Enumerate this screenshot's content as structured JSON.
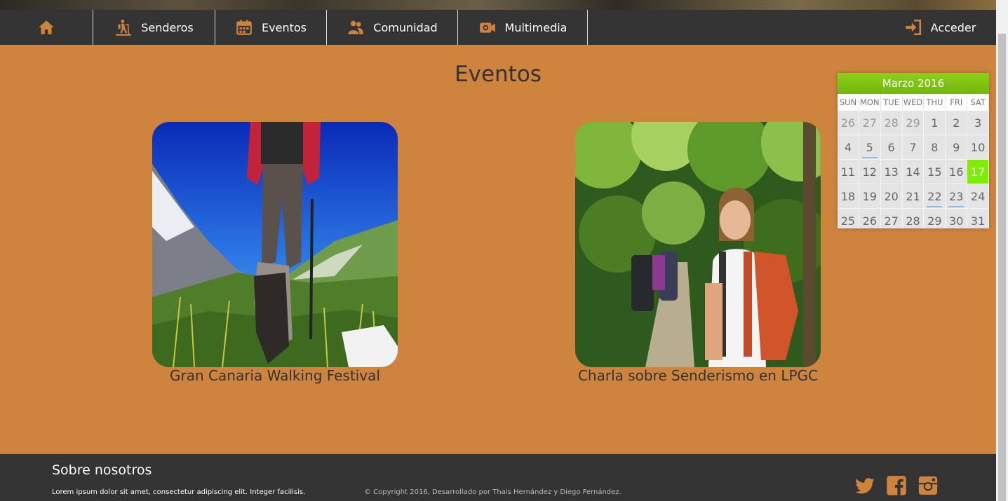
{
  "nav": {
    "home_icon": "home-icon",
    "items": [
      {
        "label": "Senderos",
        "icon": "hiker-icon"
      },
      {
        "label": "Eventos",
        "icon": "calendar-icon"
      },
      {
        "label": "Comunidad",
        "icon": "users-icon"
      },
      {
        "label": "Multimedia",
        "icon": "camera-icon"
      }
    ],
    "login": {
      "label": "Acceder",
      "icon": "sign-in-icon"
    }
  },
  "page": {
    "title": "Eventos"
  },
  "events": [
    {
      "title": "Gran Canaria Walking Festival"
    },
    {
      "title": "Charla sobre Senderismo en LPGC"
    }
  ],
  "calendar": {
    "month": "Marzo 2016",
    "weekdays": [
      "SUN",
      "MON",
      "TUE",
      "WED",
      "THU",
      "FRI",
      "SAT"
    ],
    "today": "17",
    "weeks": [
      [
        "26",
        "27",
        "28",
        "29",
        "1",
        "2",
        "3"
      ],
      [
        "4",
        "5",
        "6",
        "7",
        "8",
        "9",
        "10"
      ],
      [
        "11",
        "12",
        "13",
        "14",
        "15",
        "16",
        "17"
      ],
      [
        "18",
        "19",
        "20",
        "21",
        "22",
        "23",
        "24"
      ],
      [
        "25",
        "26",
        "27",
        "28",
        "29",
        "30",
        "31"
      ]
    ]
  },
  "footer": {
    "title": "Sobre nosotros",
    "text": "Lorem ipsum dolor sit amet, consectetur adipiscing elit. Integer facilisis.",
    "copyright": "© Copyright 2016, Desarrollado por Thais Hernández y Diego Fernández.",
    "social": [
      "twitter-icon",
      "facebook-icon",
      "instagram-icon"
    ]
  },
  "colors": {
    "accent": "#cf843e",
    "nav_bg": "#333333",
    "calendar_header": "#7ec51a",
    "today": "#7dee00",
    "icon": "#cf843e"
  }
}
